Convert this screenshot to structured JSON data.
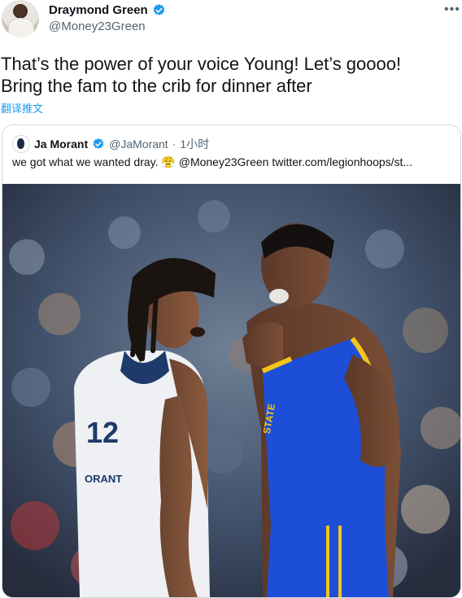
{
  "tweet": {
    "author": {
      "display_name": "Draymond Green",
      "handle": "@Money23Green"
    },
    "more_icon": "more-horizontal-icon",
    "text_line1": "That’s the power of your voice Young! Let’s goooo!",
    "text_line2": "Bring the fam to the crib for dinner after",
    "translate_label": "翻译推文"
  },
  "quote": {
    "author": {
      "display_name": "Ja Morant",
      "handle": "@JaMorant"
    },
    "separator": "·",
    "time": "1小时",
    "text_before": "we got what we wanted dray.",
    "emoji": "😤",
    "mention": "@Money23Green",
    "link": "twitter.com/legionhoops/st..."
  },
  "colors": {
    "verified": "#1d9bf0",
    "link": "#1d9bf0",
    "text": "#0f1419",
    "secondary": "#536471",
    "border": "#cfd9de",
    "grizzlies_blue": "#1d3a6b",
    "warriors_blue": "#1d4ed8",
    "warriors_gold": "#f5c518"
  }
}
